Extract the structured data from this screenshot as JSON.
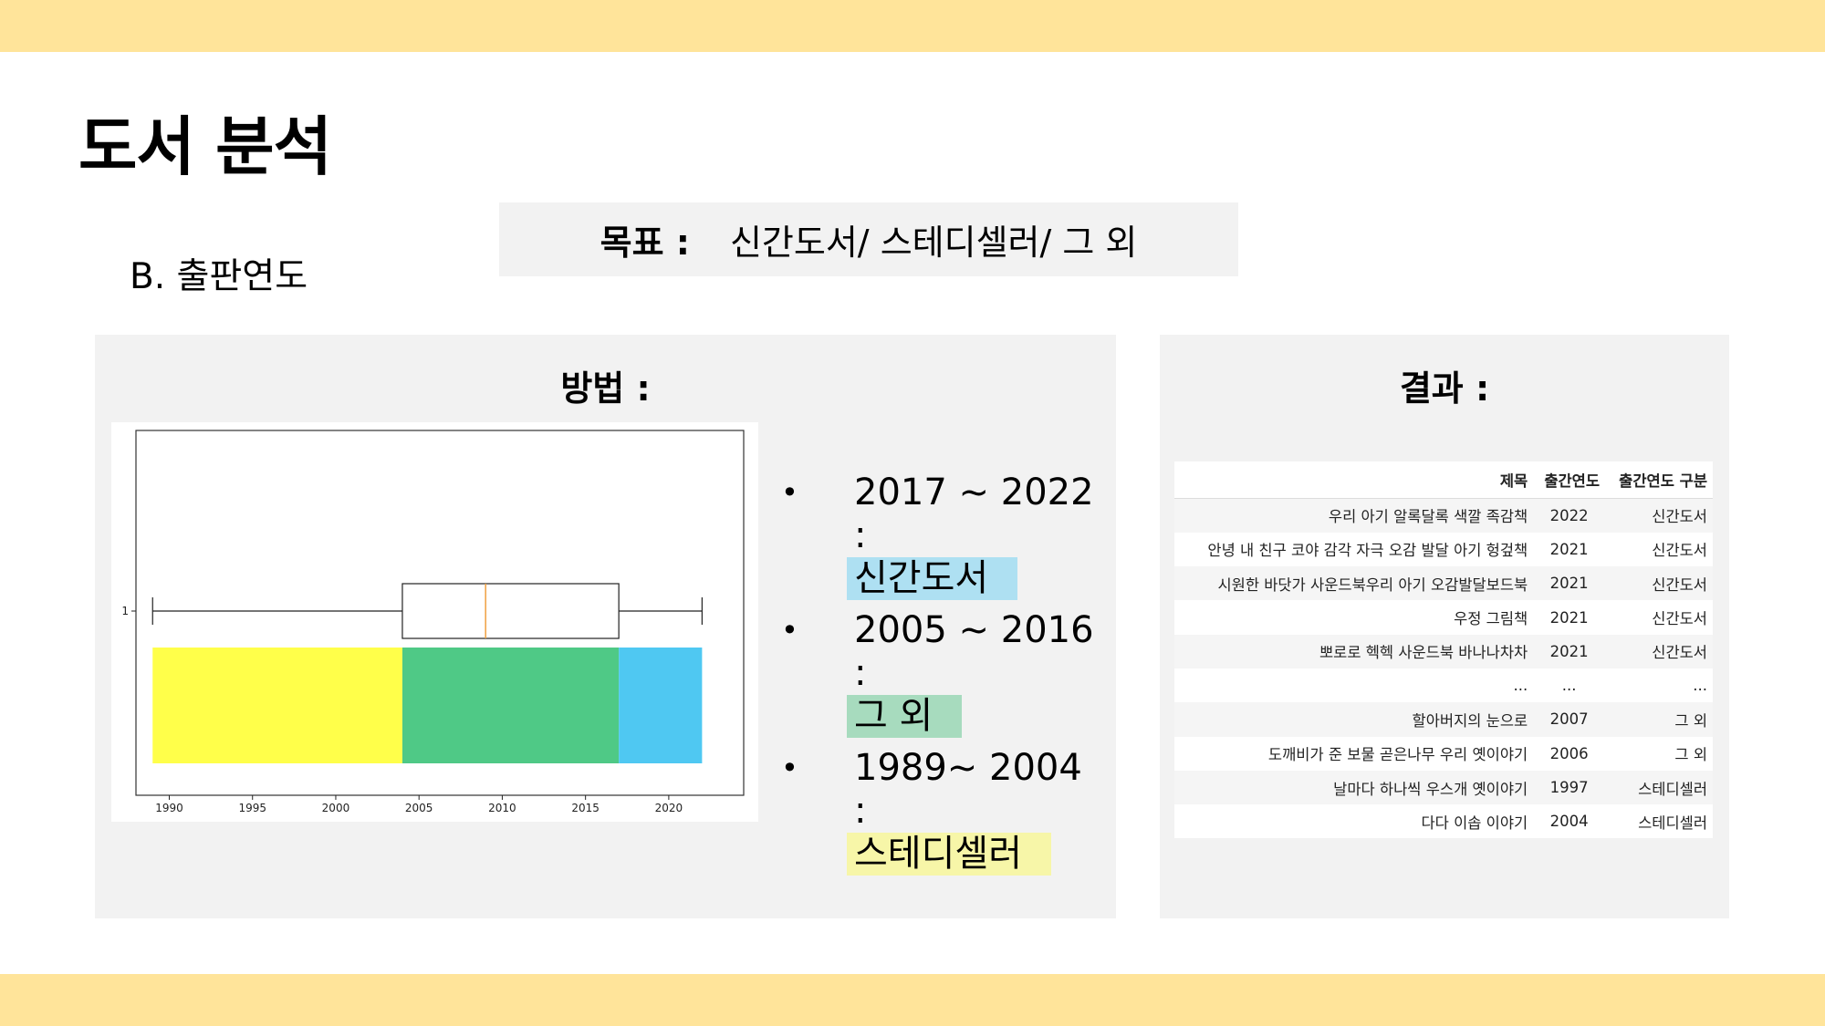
{
  "header": {
    "title": "도서 분석",
    "subtitle": "B. 출판연도"
  },
  "goal": {
    "label": "목표 :",
    "text": "신간도서/ 스테디셀러/ 그 외"
  },
  "method": {
    "title": "방법 :",
    "legend": [
      {
        "range": "2017 ~ 2022 :",
        "category": "신간도서",
        "color": "#aee0f2"
      },
      {
        "range": "2005 ~ 2016 :",
        "category": "그 외",
        "color": "#a7dbbe"
      },
      {
        "range": "1989~ 2004 :",
        "category": "스테디셀러",
        "color": "#f7f6a8"
      }
    ]
  },
  "chart_data": {
    "type": "boxplot",
    "x_ticks": [
      "1990",
      "1995",
      "2000",
      "2005",
      "2010",
      "2015",
      "2020"
    ],
    "y_ticks": [
      "1"
    ],
    "xlim": [
      1988,
      2024.5
    ],
    "box": {
      "min": 1989,
      "q1": 2004,
      "median": 2009,
      "q3": 2017,
      "max": 2022
    },
    "bands": [
      {
        "from": 1989,
        "to": 2004,
        "color": "#ffff4a"
      },
      {
        "from": 2004,
        "to": 2017,
        "color": "#4fc986"
      },
      {
        "from": 2017,
        "to": 2022,
        "color": "#4fc8f2"
      }
    ],
    "median_color": "#f0a040",
    "grid": false
  },
  "result": {
    "title": "결과 :",
    "columns": [
      "제목",
      "출간연도",
      "출간연도 구분"
    ],
    "rows": [
      [
        "우리 아기 알록달록 색깔 족감책",
        "2022",
        "신간도서"
      ],
      [
        "안녕 내 친구 코야 감각 자극 오감 발달 아기 헝겊책",
        "2021",
        "신간도서"
      ],
      [
        "시원한 바닷가 사운드북우리 아기 오감발달보드북",
        "2021",
        "신간도서"
      ],
      [
        "우정 그림책",
        "2021",
        "신간도서"
      ],
      [
        "뽀로로 헥헥 사운드북 바나나차차",
        "2021",
        "신간도서"
      ],
      [
        "...",
        "...",
        "..."
      ],
      [
        "할아버지의 눈으로",
        "2007",
        "그 외"
      ],
      [
        "도깨비가 준 보물 곧은나무 우리 옛이야기",
        "2006",
        "그 외"
      ],
      [
        "날마다 하나씩 우스개 옛이야기",
        "1997",
        "스테디셀러"
      ],
      [
        "다다 이솝 이야기",
        "2004",
        "스테디셀러"
      ]
    ]
  }
}
